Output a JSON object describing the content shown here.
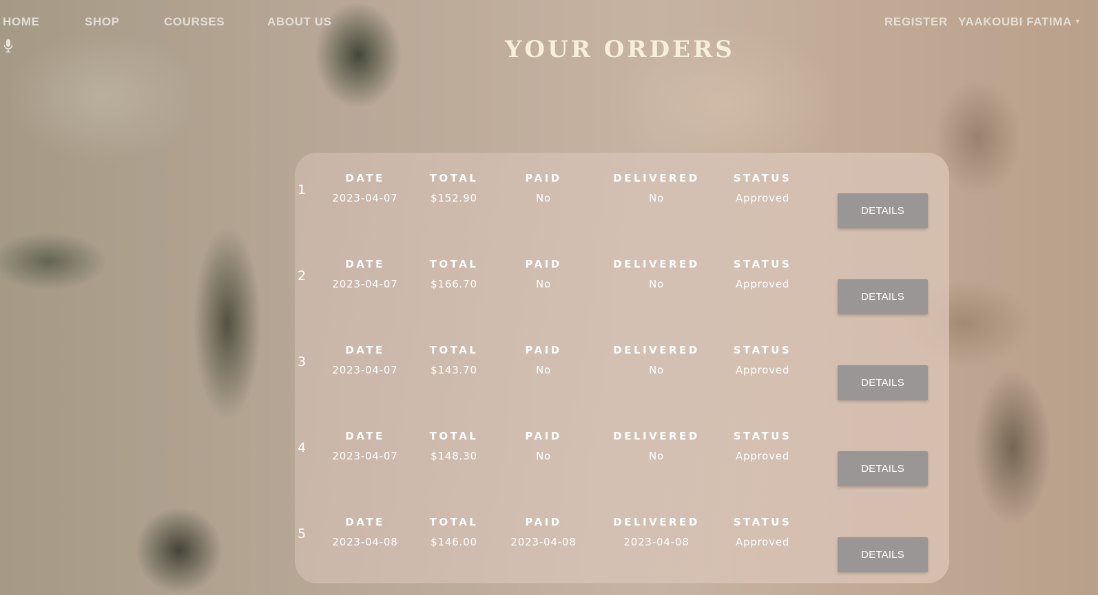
{
  "nav": {
    "home": "HOME",
    "shop": "SHOP",
    "courses": "COURSES",
    "about": "ABOUT US",
    "register": "REGISTER",
    "user": "YAAKOUBI FATIMA"
  },
  "icons": {
    "mic": "microphone-icon",
    "user_caret": "caret-down-icon"
  },
  "page": {
    "title": "YOUR ORDERS"
  },
  "columns": {
    "date": "DATE",
    "total": "TOTAL",
    "paid": "PAID",
    "delivered": "DELIVERED",
    "status": "STATUS"
  },
  "details_label": "DETAILS",
  "orders": [
    {
      "index": "1",
      "date": "2023-04-07",
      "total": "$152.90",
      "paid": "No",
      "delivered": "No",
      "status": "Approved"
    },
    {
      "index": "2",
      "date": "2023-04-07",
      "total": "$166.70",
      "paid": "No",
      "delivered": "No",
      "status": "Approved"
    },
    {
      "index": "3",
      "date": "2023-04-07",
      "total": "$143.70",
      "paid": "No",
      "delivered": "No",
      "status": "Approved"
    },
    {
      "index": "4",
      "date": "2023-04-07",
      "total": "$148.30",
      "paid": "No",
      "delivered": "No",
      "status": "Approved"
    },
    {
      "index": "5",
      "date": "2023-04-08",
      "total": "$146.00",
      "paid": "2023-04-08",
      "delivered": "2023-04-08",
      "status": "Approved"
    }
  ],
  "colors": {
    "title": "#f7efd9",
    "button_bg": "#999695",
    "text": "#ffffff"
  }
}
